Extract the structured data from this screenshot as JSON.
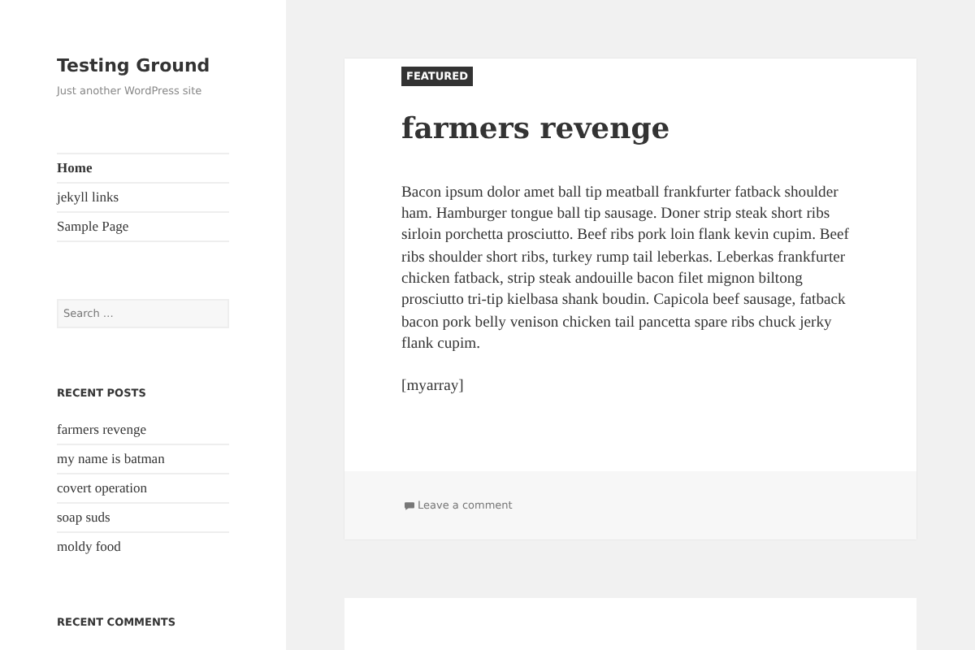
{
  "site": {
    "title": "Testing Ground",
    "tagline": "Just another WordPress site"
  },
  "menu": [
    {
      "label": "Home",
      "selected": true
    },
    {
      "label": "jekyll links",
      "selected": false
    },
    {
      "label": "Sample Page",
      "selected": false
    }
  ],
  "search": {
    "placeholder": "Search …"
  },
  "recent_posts": {
    "heading": "RECENT POSTS",
    "items": [
      "farmers revenge",
      "my name is batman",
      "covert operation",
      "soap suds",
      "moldy food"
    ]
  },
  "recent_comments": {
    "heading": "RECENT COMMENTS"
  },
  "post": {
    "badge": "FEATURED",
    "title": "farmers revenge",
    "paragraphs": [
      "Bacon ipsum dolor amet ball tip meatball frankfurter fatback shoulder ham. Hamburger tongue ball tip sausage. Doner strip steak short ribs sirloin porchetta prosciutto. Beef ribs pork loin flank kevin cupim. Beef ribs shoulder short ribs, turkey rump tail leberkas. Leberkas frankfurter chicken fatback, strip steak andouille bacon filet mignon biltong prosciutto tri-tip kielbasa shank boudin. Capicola beef sausage, fatback bacon pork belly venison chicken tail pancetta spare ribs chuck jerky flank cupim.",
      "[myarray]"
    ],
    "footer_link": "Leave a comment"
  }
}
